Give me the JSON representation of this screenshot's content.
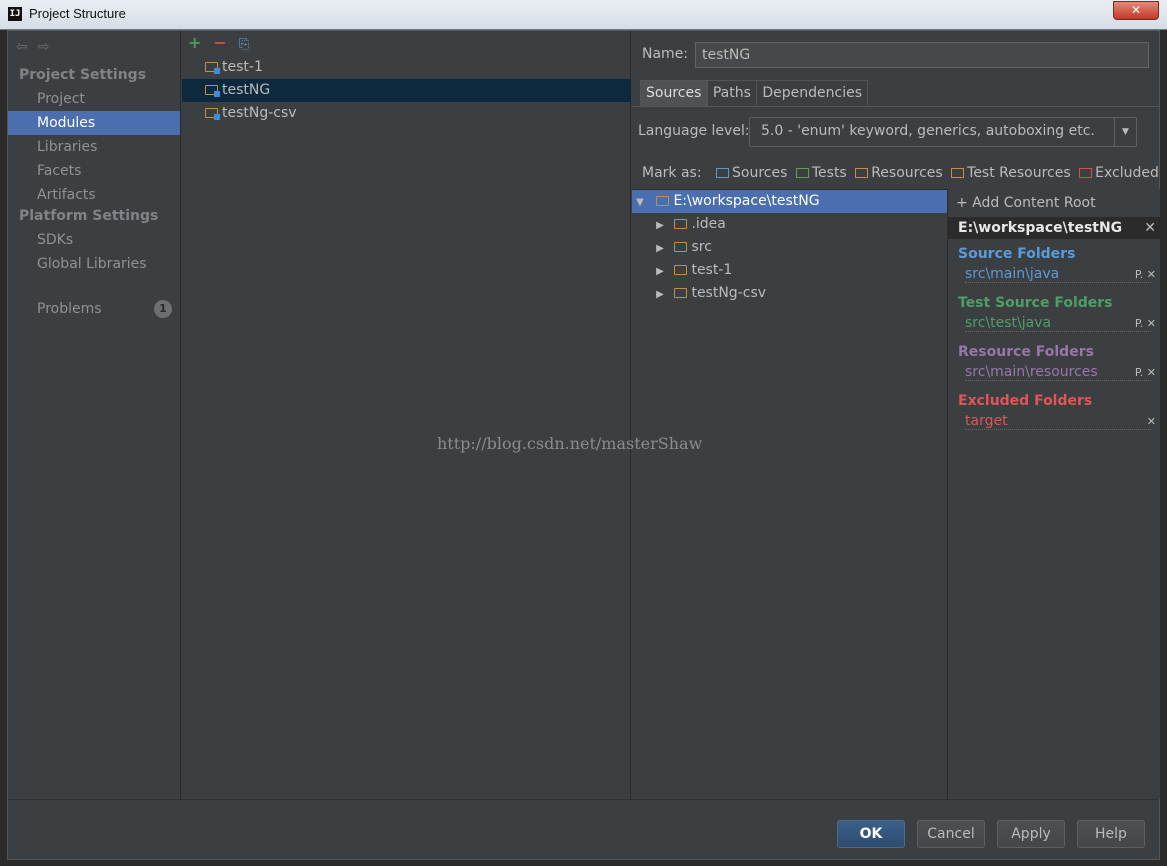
{
  "window": {
    "title": "Project Structure",
    "app_icon_text": "IJ",
    "close_label": "✕"
  },
  "sidebar": {
    "nav": {
      "back": "⇦",
      "forward": "⇨"
    },
    "project_settings_title": "Project Settings",
    "project_items": [
      "Project",
      "Modules",
      "Libraries",
      "Facets",
      "Artifacts"
    ],
    "platform_settings_title": "Platform Settings",
    "platform_items": [
      "SDKs",
      "Global Libraries"
    ],
    "problems_label": "Problems",
    "problems_count": "1",
    "selected": "Modules"
  },
  "modules": {
    "toolbar": {
      "add": "+",
      "remove": "−",
      "copy": "⎘"
    },
    "items": [
      "test-1",
      "testNG",
      "testNg-csv"
    ],
    "selected": "testNG"
  },
  "detail": {
    "name_label": "Name:",
    "name_value": "testNG",
    "tabs": [
      "Sources",
      "Paths",
      "Dependencies"
    ],
    "active_tab": "Sources",
    "language_level_label": "Language level:",
    "language_level_value": "5.0 - 'enum' keyword, generics, autoboxing etc.",
    "mark_as_label": "Mark as:",
    "mark_buttons": [
      {
        "label": "Sources",
        "color": "#6897bb"
      },
      {
        "label": "Tests",
        "color": "#6a9955"
      },
      {
        "label": "Resources",
        "color": "#c48d48"
      },
      {
        "label": "Test Resources",
        "color": "#c48d48"
      },
      {
        "label": "Excluded",
        "color": "#d05050"
      }
    ],
    "tree": {
      "root": "E:\\workspace\\testNG",
      "children": [
        ".idea",
        "src",
        "test-1",
        "testNg-csv"
      ]
    },
    "roots": {
      "add_content_root": "+ Add Content Root",
      "root_path": "E:\\workspace\\testNG",
      "source_folders_title": "Source Folders",
      "source_folder": "src\\main\\java",
      "test_source_folders_title": "Test Source Folders",
      "test_source_folder": "src\\test\\java",
      "resource_folders_title": "Resource Folders",
      "resource_folder": "src\\main\\resources",
      "excluded_folders_title": "Excluded Folders",
      "excluded_folder": "target",
      "colors": {
        "source": "#5a9bd8",
        "test": "#4f9e66",
        "resource": "#9876aa",
        "excluded": "#e05555"
      }
    }
  },
  "watermark": "http://blog.csdn.net/masterShaw",
  "footer": {
    "ok": "OK",
    "cancel": "Cancel",
    "apply": "Apply",
    "help": "Help"
  }
}
